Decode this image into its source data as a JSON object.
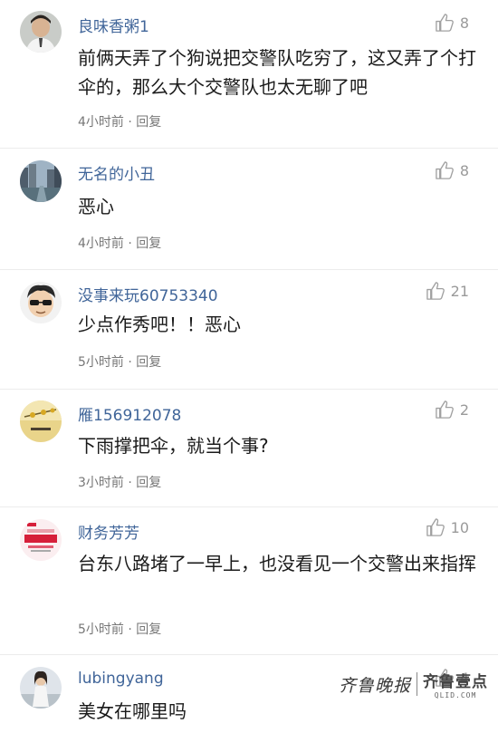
{
  "comments": [
    {
      "username": "良味香粥1",
      "likes": "8",
      "text": "前俩天弄了个狗说把交警队吃穷了，这又弄了个打伞的，那么大个交警队也太无聊了吧",
      "time": "4小时前",
      "separator": "·",
      "reply": "回复",
      "avatar_icon": "man-portrait-avatar"
    },
    {
      "username": "无名的小丑",
      "likes": "8",
      "text": "恶心",
      "time": "4小时前",
      "separator": "·",
      "reply": "回复",
      "avatar_icon": "city-street-avatar"
    },
    {
      "username": "没事来玩60753340",
      "likes": "21",
      "text": "少点作秀吧！！恶心",
      "time": "5小时前",
      "separator": "·",
      "reply": "回复",
      "avatar_icon": "sunglasses-cartoon-avatar"
    },
    {
      "username": "雁156912078",
      "likes": "2",
      "text": "下雨撑把伞，就当个事?",
      "time": "3小时前",
      "separator": "·",
      "reply": "回复",
      "avatar_icon": "yellow-flower-avatar"
    },
    {
      "username": "财务芳芳",
      "likes": "10",
      "text": "台东八路堵了一早上，也没看见一个交警出来指挥",
      "time": "5小时前",
      "separator": "·",
      "reply": "回复",
      "avatar_icon": "promo-poster-avatar"
    },
    {
      "username": "lubingyang",
      "likes": "4",
      "text": "美女在哪里吗",
      "avatar_icon": "woman-photo-avatar"
    }
  ],
  "watermark": {
    "left": "齐鲁晚报",
    "right": "齐鲁壹点",
    "domain": "QLID.COM"
  },
  "colors": {
    "username": "#406599",
    "text": "#1a1a1a",
    "meta": "#777777",
    "like": "#9a9a9a"
  }
}
